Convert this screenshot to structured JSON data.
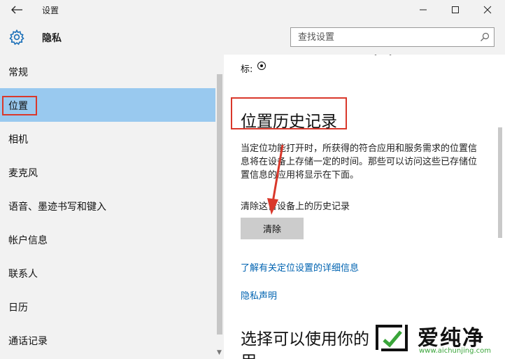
{
  "window": {
    "title": "设置"
  },
  "header": {
    "title": "隐私",
    "search_placeholder": "查找设置"
  },
  "sidebar": {
    "items": [
      {
        "label": "常规"
      },
      {
        "label": "位置"
      },
      {
        "label": "相机"
      },
      {
        "label": "麦克风"
      },
      {
        "label": "语音、墨迹书写和键入"
      },
      {
        "label": "帐户信息"
      },
      {
        "label": "联系人"
      },
      {
        "label": "日历"
      },
      {
        "label": "通话记录"
      }
    ],
    "selected": "位置"
  },
  "content": {
    "top_fragment": "标:",
    "section_title": "位置历史记录",
    "description": "当定位功能打开时，所获得的符合应用和服务需求的位置信息将在设备上存储一定的时间。那些可以访问这些已存储位置信息的应用将显示在下面。",
    "clear_label": "清除这台设备上的历史记录",
    "clear_button": "清除",
    "link_details": "了解有关定位设置的详细信息",
    "link_privacy": "隐私声明",
    "next_title": "选择可以使用你的",
    "next_title_line2": "用"
  },
  "watermark": {
    "text": "爱纯净",
    "url": "www.aichunjing.com"
  },
  "colors": {
    "selected": "#99c9ef",
    "highlight": "#d9382b",
    "link": "#0063b1"
  }
}
